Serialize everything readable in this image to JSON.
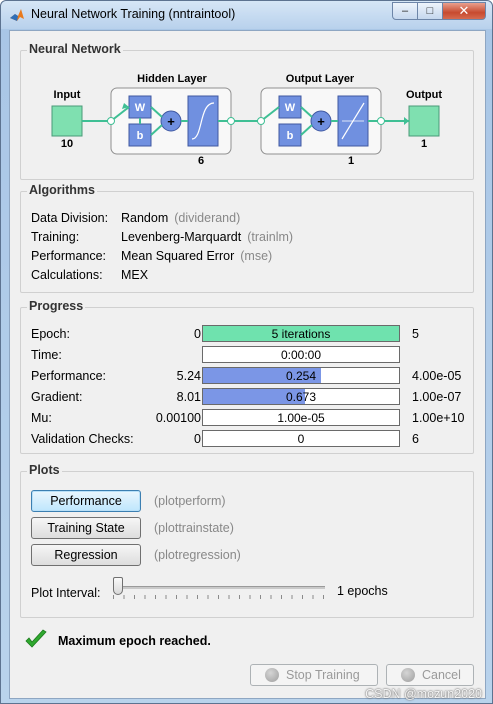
{
  "window": {
    "title": "Neural Network Training (nntraintool)",
    "controls": [
      "minimize-icon",
      "maximize-icon",
      "close-icon"
    ]
  },
  "network": {
    "section_title": "Neural Network",
    "input_label": "Input",
    "input_size": "10",
    "hidden_label": "Hidden Layer",
    "hidden_size": "6",
    "output_layer_label": "Output Layer",
    "output_layer_size": "1",
    "output_label": "Output",
    "output_size": "1",
    "weight_symbol": "W",
    "bias_symbol": "b",
    "sum_symbol": "+",
    "colors": {
      "node": "#7fe0b0",
      "block": "#7090e0",
      "line": "#3fbf94"
    }
  },
  "algorithms": {
    "section_title": "Algorithms",
    "rows": [
      {
        "label": "Data Division:",
        "value": "Random",
        "func": "(dividerand)"
      },
      {
        "label": "Training:",
        "value": "Levenberg-Marquardt",
        "func": "(trainlm)"
      },
      {
        "label": "Performance:",
        "value": "Mean Squared Error",
        "func": "(mse)"
      },
      {
        "label": "Calculations:",
        "value": "MEX",
        "func": ""
      }
    ]
  },
  "progress": {
    "section_title": "Progress",
    "rows": [
      {
        "label": "Epoch:",
        "min": "0",
        "text": "5 iterations",
        "max": "5",
        "fill": 1.0,
        "color": "#6fe2ae"
      },
      {
        "label": "Time:",
        "min": "",
        "text": "0:00:00",
        "max": "",
        "fill": 0.0,
        "color": "#7b96e6"
      },
      {
        "label": "Performance:",
        "min": "5.24",
        "text": "0.254",
        "max": "4.00e-05",
        "fill": 0.6,
        "color": "#7b96e6"
      },
      {
        "label": "Gradient:",
        "min": "8.01",
        "text": "0.673",
        "max": "1.00e-07",
        "fill": 0.52,
        "color": "#7b96e6"
      },
      {
        "label": "Mu:",
        "min": "0.00100",
        "text": "1.00e-05",
        "max": "1.00e+10",
        "fill": 0.0,
        "color": "#7b96e6"
      },
      {
        "label": "Validation Checks:",
        "min": "0",
        "text": "0",
        "max": "6",
        "fill": 0.0,
        "color": "#7b96e6"
      }
    ]
  },
  "plots": {
    "section_title": "Plots",
    "buttons": [
      {
        "label": "Performance",
        "func": "(plotperform)"
      },
      {
        "label": "Training State",
        "func": "(plottrainstate)"
      },
      {
        "label": "Regression",
        "func": "(plotregression)"
      }
    ],
    "interval_label": "Plot Interval:",
    "interval_value": "1 epochs",
    "interval_fraction": 0.0
  },
  "status": {
    "message": "Maximum epoch reached.",
    "icon": "checkmark-icon",
    "color": "#2fa82f"
  },
  "footer": {
    "stop_label": "Stop Training",
    "cancel_label": "Cancel"
  },
  "watermark": "CSDN @mozun2020"
}
